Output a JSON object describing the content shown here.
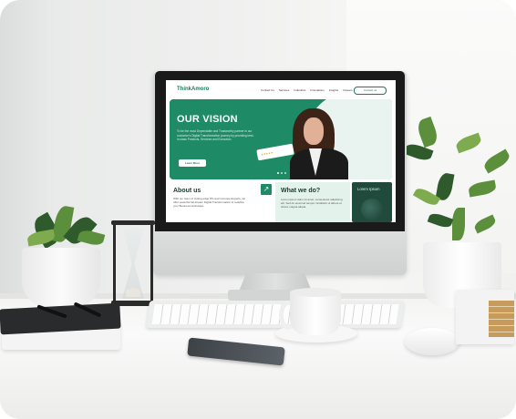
{
  "scene": {
    "description_objects": [
      "desktop-monitor",
      "keyboard",
      "coffee-mug",
      "mouse",
      "smartphone",
      "notebooks",
      "hourglass",
      "potted-plants",
      "books"
    ]
  },
  "website": {
    "logo": "ThinkAmoro",
    "nav": [
      "Contact Us",
      "Services",
      "Industries",
      "Innovations",
      "Insights",
      "Careers"
    ],
    "contact_button": "Contact us",
    "hero": {
      "title": "OUR VISION",
      "text": "To be the most Dependable and Trustworthy partner in our customer's Digital Transformation journey by providing best-in-class Products, Services and Execution.",
      "button": "Learn More",
      "rating": "★★★★★"
    },
    "about": {
      "title": "About us",
      "text": "With our team of cutting-edge IPs and in-house Experts, we offer powerful full-stream Digital Transformation to redefine your Business landscape."
    },
    "what": {
      "title": "What we do?",
      "text": "Lorem ipsum dolor sit amet, consectetur adipiscing elit. Sed do eiusmod tempor incididunt ut labore et dolore magna aliqua."
    },
    "lorem": {
      "title": "Lorem Ipsum"
    }
  },
  "colors": {
    "brand_green": "#1e8a66",
    "dark_green": "#1f4a3c"
  }
}
